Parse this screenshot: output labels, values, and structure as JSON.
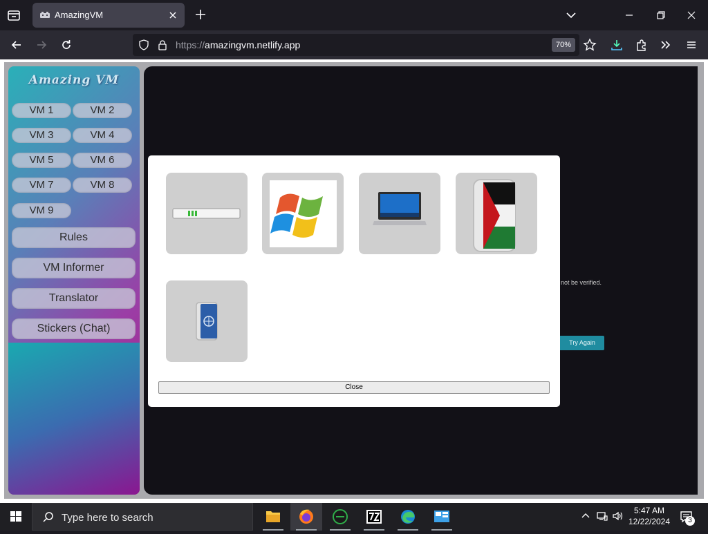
{
  "browser": {
    "tab": {
      "title": "AmazingVM"
    },
    "url": {
      "prefix": "https://",
      "host": "amazingvm.netlify.app"
    },
    "zoom": "70%"
  },
  "sidebar": {
    "logo": "Amazing VM",
    "vm_buttons": [
      "VM 1",
      "VM 2",
      "VM 3",
      "VM 4",
      "VM 5",
      "VM 6",
      "VM 7",
      "VM 8",
      "VM 9"
    ],
    "menu": [
      "Rules",
      "VM Informer",
      "Translator",
      "Stickers (Chat)"
    ]
  },
  "background": {
    "message_fragment": "not be verified.",
    "retry_label": "Try Again"
  },
  "modal": {
    "tiles": [
      {
        "icon": "loading-bar-icon"
      },
      {
        "icon": "windows-flag-icon"
      },
      {
        "icon": "laptop-icon"
      },
      {
        "icon": "palestine-flag-icon"
      },
      {
        "icon": "un-flag-icon"
      }
    ],
    "close_label": "Close"
  },
  "taskbar": {
    "search_placeholder": "Type here to search",
    "apps": [
      "file-explorer",
      "firefox",
      "terminal-app",
      "7-zip",
      "edge",
      "control-panel"
    ],
    "active_app": "firefox",
    "clock_time": "5:47 AM",
    "clock_date": "12/22/2024",
    "notification_count": "3"
  },
  "colors": {
    "sidebar_gradient_start": "#2ab0b8",
    "sidebar_gradient_end": "#a5157e",
    "retry_button": "#1f8ca0"
  }
}
